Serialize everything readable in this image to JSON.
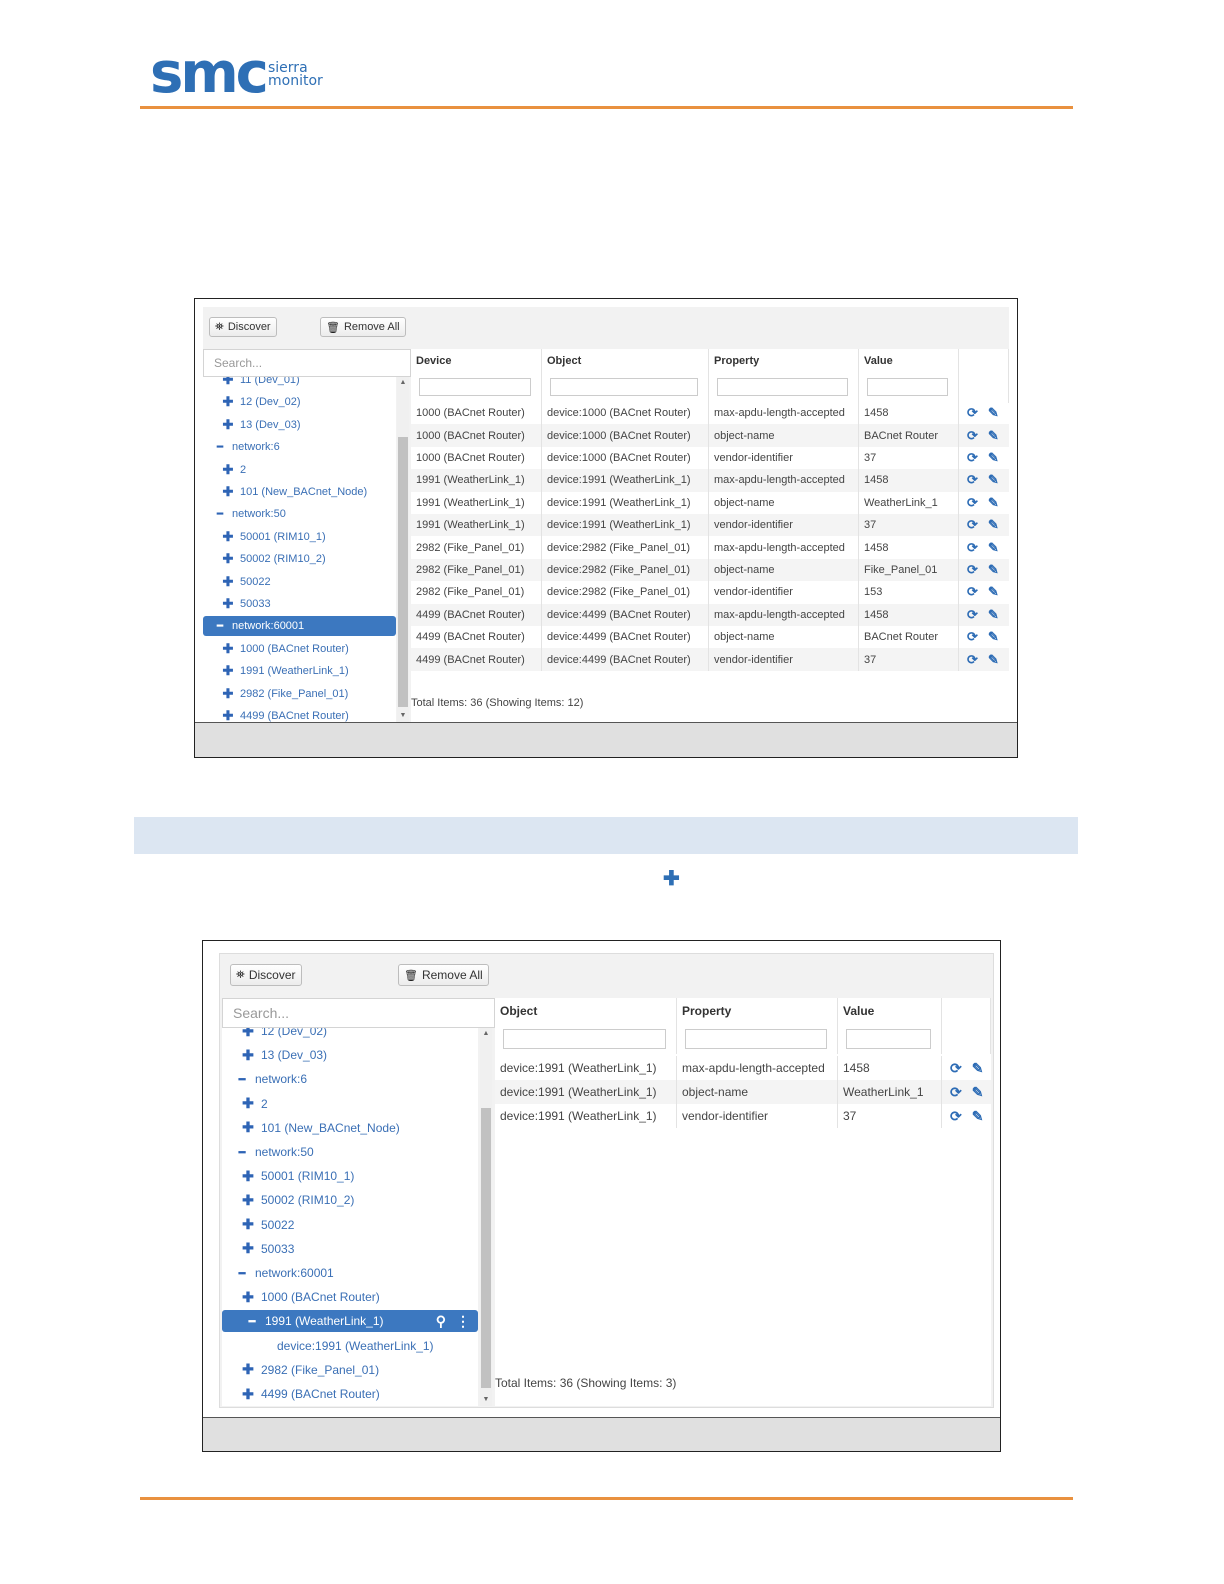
{
  "header": {
    "logo_mark": "smc",
    "logo_sub_1": "sierra",
    "logo_sub_2": "monitor",
    "accent_color": "#e9913f",
    "brand_color": "#2e6fb5"
  },
  "screen1": {
    "discover_label": "Discover",
    "remove_all_label": "Remove All",
    "search_placeholder": "Search...",
    "columns": [
      "Device",
      "Object",
      "Property",
      "Value"
    ],
    "tree": [
      {
        "kind": "plus",
        "label": "11 (Dev_01)"
      },
      {
        "kind": "plus",
        "label": "12 (Dev_02)"
      },
      {
        "kind": "plus",
        "label": "13 (Dev_03)"
      },
      {
        "kind": "minus",
        "label": "network:6"
      },
      {
        "kind": "plus",
        "label": "2"
      },
      {
        "kind": "plus",
        "label": "101 (New_BACnet_Node)"
      },
      {
        "kind": "minus",
        "label": "network:50"
      },
      {
        "kind": "plus",
        "label": "50001 (RIM10_1)"
      },
      {
        "kind": "plus",
        "label": "50002 (RIM10_2)"
      },
      {
        "kind": "plus",
        "label": "50022"
      },
      {
        "kind": "plus",
        "label": "50033"
      },
      {
        "kind": "minus",
        "label": "network:60001",
        "selected": true
      },
      {
        "kind": "plus",
        "label": "1000 (BACnet Router)"
      },
      {
        "kind": "plus",
        "label": "1991 (WeatherLink_1)"
      },
      {
        "kind": "plus",
        "label": "2982 (Fike_Panel_01)"
      },
      {
        "kind": "plus",
        "label": "4499 (BACnet Router)"
      }
    ],
    "rows": [
      [
        "1000 (BACnet Router)",
        "device:1000 (BACnet Router)",
        "max-apdu-length-accepted",
        "1458"
      ],
      [
        "1000 (BACnet Router)",
        "device:1000 (BACnet Router)",
        "object-name",
        "BACnet Router"
      ],
      [
        "1000 (BACnet Router)",
        "device:1000 (BACnet Router)",
        "vendor-identifier",
        "37"
      ],
      [
        "1991 (WeatherLink_1)",
        "device:1991 (WeatherLink_1)",
        "max-apdu-length-accepted",
        "1458"
      ],
      [
        "1991 (WeatherLink_1)",
        "device:1991 (WeatherLink_1)",
        "object-name",
        "WeatherLink_1"
      ],
      [
        "1991 (WeatherLink_1)",
        "device:1991 (WeatherLink_1)",
        "vendor-identifier",
        "37"
      ],
      [
        "2982 (Fike_Panel_01)",
        "device:2982 (Fike_Panel_01)",
        "max-apdu-length-accepted",
        "1458"
      ],
      [
        "2982 (Fike_Panel_01)",
        "device:2982 (Fike_Panel_01)",
        "object-name",
        "Fike_Panel_01"
      ],
      [
        "2982 (Fike_Panel_01)",
        "device:2982 (Fike_Panel_01)",
        "vendor-identifier",
        "153"
      ],
      [
        "4499 (BACnet Router)",
        "device:4499 (BACnet Router)",
        "max-apdu-length-accepted",
        "1458"
      ],
      [
        "4499 (BACnet Router)",
        "device:4499 (BACnet Router)",
        "object-name",
        "BACnet Router"
      ],
      [
        "4499 (BACnet Router)",
        "device:4499 (BACnet Router)",
        "vendor-identifier",
        "37"
      ]
    ],
    "total": "Total Items: 36 (Showing Items: 12)"
  },
  "screen2": {
    "discover_label": "Discover",
    "remove_all_label": "Remove All",
    "search_placeholder": "Search...",
    "columns": [
      "Object",
      "Property",
      "Value"
    ],
    "tree": [
      {
        "kind": "plus",
        "label": "12 (Dev_02)"
      },
      {
        "kind": "plus",
        "label": "13 (Dev_03)"
      },
      {
        "kind": "minus",
        "label": "network:6"
      },
      {
        "kind": "plus",
        "label": "2"
      },
      {
        "kind": "plus",
        "label": "101 (New_BACnet_Node)"
      },
      {
        "kind": "minus",
        "label": "network:50"
      },
      {
        "kind": "plus",
        "label": "50001 (RIM10_1)"
      },
      {
        "kind": "plus",
        "label": "50002 (RIM10_2)"
      },
      {
        "kind": "plus",
        "label": "50022"
      },
      {
        "kind": "plus",
        "label": "50033"
      },
      {
        "kind": "minus",
        "label": "network:60001"
      },
      {
        "kind": "plus",
        "label": "1000 (BACnet Router)"
      },
      {
        "kind": "minus",
        "label": "1991 (WeatherLink_1)",
        "selected": true
      },
      {
        "kind": "leaf",
        "label": "device:1991 (WeatherLink_1)"
      },
      {
        "kind": "plus",
        "label": "2982 (Fike_Panel_01)"
      },
      {
        "kind": "plus",
        "label": "4499 (BACnet Router)"
      }
    ],
    "rows": [
      [
        "device:1991 (WeatherLink_1)",
        "max-apdu-length-accepted",
        "1458"
      ],
      [
        "device:1991 (WeatherLink_1)",
        "object-name",
        "WeatherLink_1"
      ],
      [
        "device:1991 (WeatherLink_1)",
        "vendor-identifier",
        "37"
      ]
    ],
    "total": "Total Items: 36 (Showing Items: 3)"
  },
  "section_plus_glyph": "✚"
}
